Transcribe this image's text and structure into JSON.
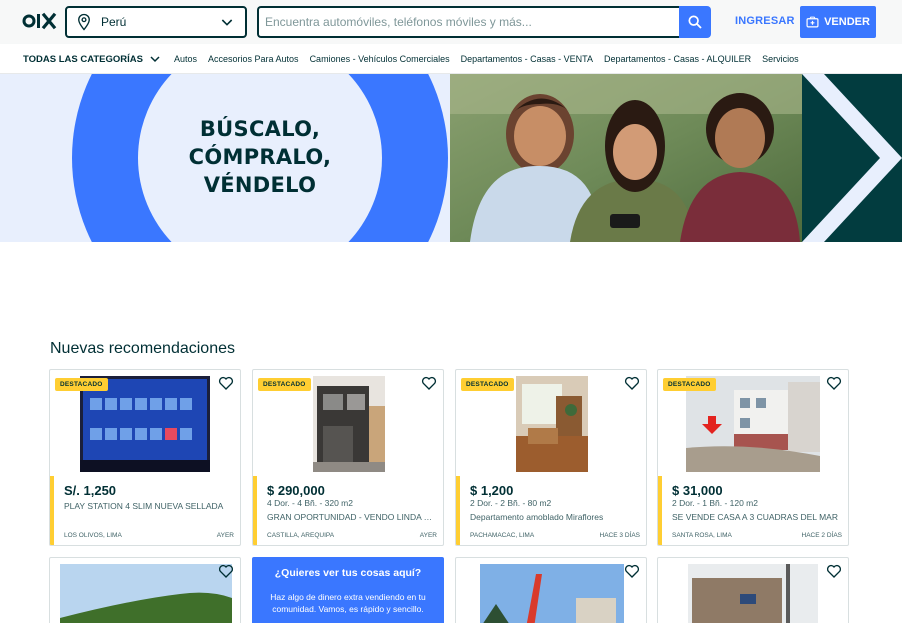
{
  "header": {
    "logo": "OLX",
    "location": "Perú",
    "search_placeholder": "Encuentra automóviles, teléfonos móviles y más...",
    "login_label": "INGRESAR",
    "sell_label": "VENDER",
    "accent_color": "#3a77ff",
    "dark_color": "#002f34"
  },
  "categories": {
    "all_label": "TODAS LAS CATEGORÍAS",
    "items": [
      "Autos",
      "Accesorios Para Autos",
      "Camiones - Vehículos Comerciales",
      "Departamentos - Casas - VENTA",
      "Departamentos - Casas - ALQUILER",
      "Servicios"
    ]
  },
  "banner": {
    "line1": "BÚSCALO,",
    "line2": "CÓMPRALO,",
    "line3": "VÉNDELO"
  },
  "recommendations": {
    "title": "Nuevas recomendaciones",
    "badge_label": "DESTACADO",
    "cards": [
      {
        "price": "S/. 1,250",
        "specs": "",
        "title": "PLAY STATION 4 SLIM NUEVA SELLADA",
        "location": "Los Olivos, Lima",
        "date": "Ayer",
        "image_icon": "tv-console-photo"
      },
      {
        "price": "$ 290,000",
        "specs": "4 Dor. - 4 Bñ. - 320 m2",
        "title": "GRAN OPORTUNIDAD - VENDO LINDA CASA",
        "location": "Castilla, Arequipa",
        "date": "Ayer",
        "image_icon": "house-photo"
      },
      {
        "price": "$ 1,200",
        "specs": "2 Dor. - 2 Bñ. - 80 m2",
        "title": "Departamento amoblado Miraflores",
        "location": "Pachamacac, Lima",
        "date": "Hace 3 días",
        "image_icon": "apartment-photo"
      },
      {
        "price": "$ 31,000",
        "specs": "2 Dor. - 1 Bñ. - 120 m2",
        "title": "SE VENDE CASA A 3 CUADRAS DEL MAR",
        "location": "Santa Rosa, Lima",
        "date": "Hace 2 días",
        "image_icon": "street-photo"
      }
    ],
    "promo": {
      "title": "¿Quieres ver tus cosas aquí?",
      "text": "Haz algo de dinero extra vendiendo en tu comunidad. Vamos, es rápido y sencillo."
    }
  }
}
